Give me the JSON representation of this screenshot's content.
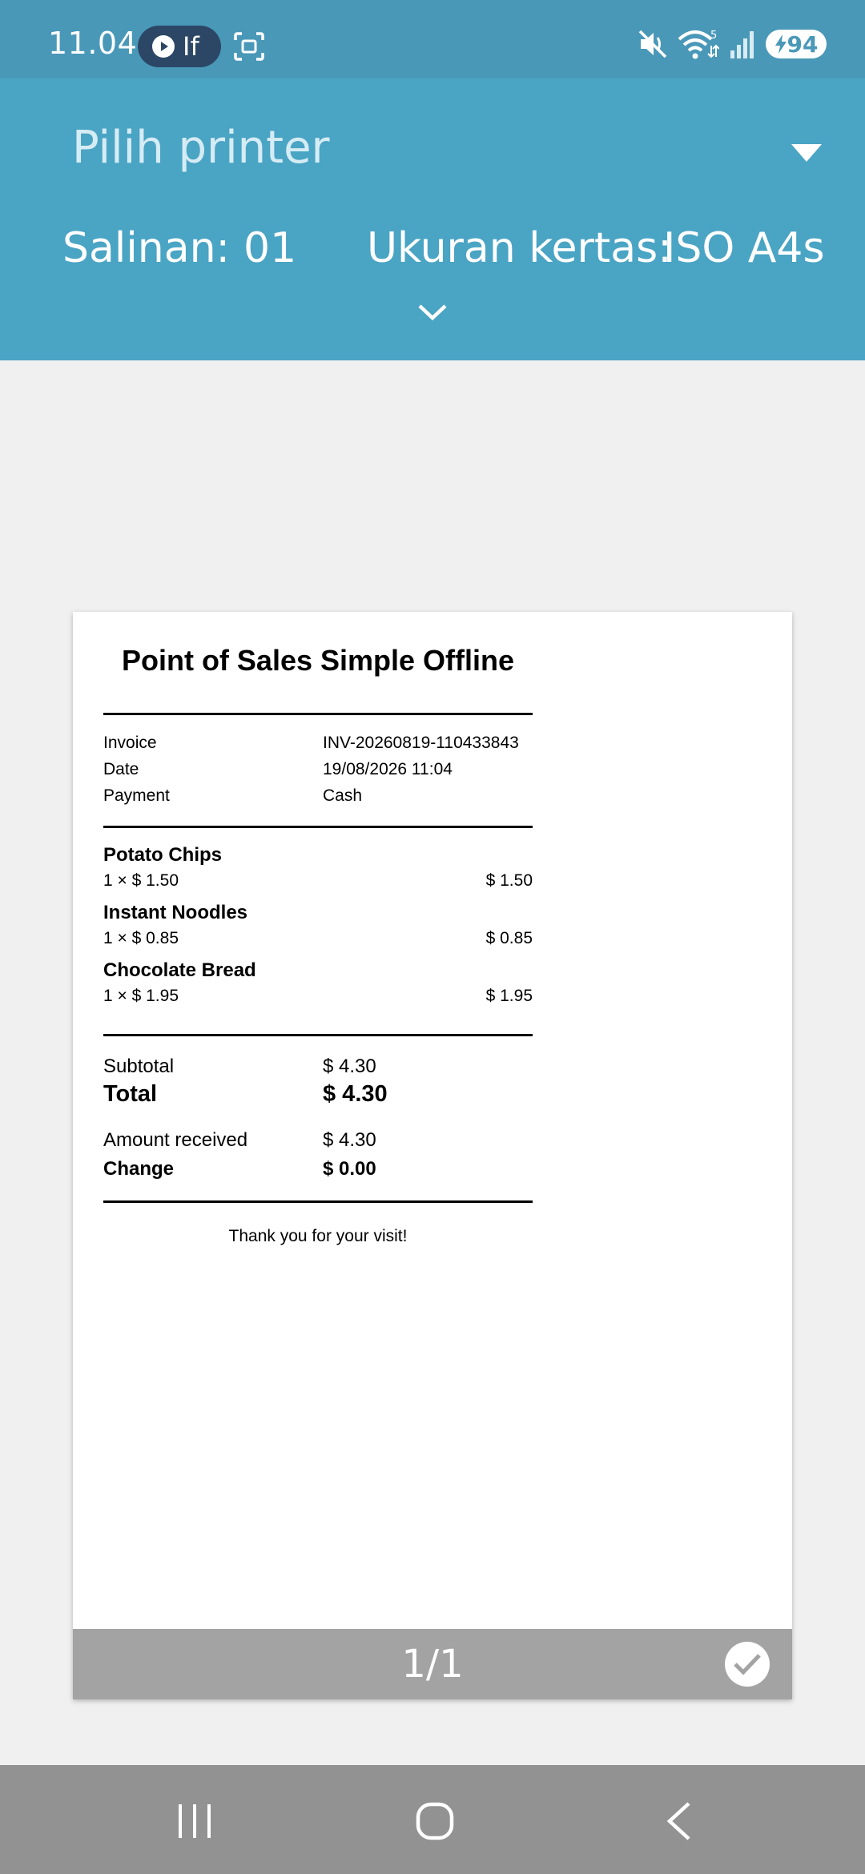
{
  "status_bar": {
    "time": "11.04",
    "pill_text": "If",
    "battery": "94",
    "icons": [
      "play-circle-icon",
      "screenshot-icon",
      "mute-icon",
      "wifi-icon",
      "signal-icon",
      "battery-charging-icon"
    ],
    "background": "#4a98b8"
  },
  "print_header": {
    "printer_select": "Pilih printer",
    "copies_label": "Salinan:",
    "copies_value": "01",
    "paper_label": "Ukuran kertas:",
    "paper_value": "ISO A4s",
    "background": "#4aa4c4"
  },
  "receipt": {
    "title": "Point of Sales Simple Offline",
    "meta": [
      {
        "label": "Invoice",
        "value": "INV-20260819-110433843"
      },
      {
        "label": "Date",
        "value": "19/08/2026 11:04"
      },
      {
        "label": "Payment",
        "value": "Cash"
      }
    ],
    "items": [
      {
        "name": "Potato Chips",
        "qty_price": "1 × $ 1.50",
        "amount": "$ 1.50"
      },
      {
        "name": "Instant Noodles",
        "qty_price": "1 × $ 0.85",
        "amount": "$ 0.85"
      },
      {
        "name": "Chocolate Bread",
        "qty_price": "1 × $ 1.95",
        "amount": "$ 1.95"
      }
    ],
    "subtotal_label": "Subtotal",
    "subtotal_value": "$ 4.30",
    "total_label": "Total",
    "total_value": "$ 4.30",
    "received_label": "Amount received",
    "received_value": "$ 4.30",
    "change_label": "Change",
    "change_value": "$ 0.00",
    "thanks": "Thank you for your visit!"
  },
  "page_footer": {
    "page_number": "1/1"
  },
  "nav_bar": {
    "icons": [
      "recents-icon",
      "home-icon",
      "back-icon"
    ],
    "background": "#929292"
  }
}
